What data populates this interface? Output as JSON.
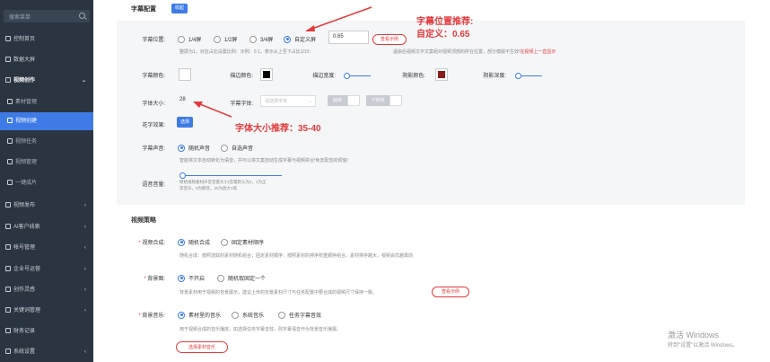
{
  "sidebar": {
    "search_placeholder": "搜索菜单",
    "items": [
      {
        "label": "控制首页",
        "icon": "home-icon"
      },
      {
        "label": "数据大屏",
        "icon": "chart-icon"
      },
      {
        "label": "视频创作",
        "icon": "video-icon"
      },
      {
        "label": "素材管理",
        "icon": "image-icon"
      },
      {
        "label": "视频创建",
        "icon": "edit-icon"
      },
      {
        "label": "视频任务",
        "icon": "task-icon"
      },
      {
        "label": "视频管理",
        "icon": "folder-icon"
      },
      {
        "label": "一键成片",
        "icon": "magic-icon"
      },
      {
        "label": "视频发布",
        "icon": "send-icon"
      },
      {
        "label": "AI客户线索",
        "icon": "user-icon"
      },
      {
        "label": "帐号管理",
        "icon": "account-icon"
      },
      {
        "label": "企业号运营",
        "icon": "building-icon"
      },
      {
        "label": "创作灵感",
        "icon": "idea-icon"
      },
      {
        "label": "关键词管理",
        "icon": "key-icon"
      },
      {
        "label": "财务记录",
        "icon": "money-icon"
      },
      {
        "label": "系统设置",
        "icon": "gear-icon"
      }
    ]
  },
  "subtitle": {
    "section_title": "字幕配置",
    "collapse_label": "收起",
    "position_label": "字幕位置:",
    "position_options": [
      "1/4屏",
      "1/2屏",
      "3/4屏",
      "自定义屏"
    ],
    "position_selected": "自定义屏",
    "position_value": "0.65",
    "view_example": "查看示例",
    "position_hint": "整屏为1，对应占比设置比例：示例：0.1，表示从上至下占比1/10;",
    "position_hint2": "温染后视频文字文案组对视频顶部的所在位置，部分模版不生效!",
    "position_hint_red": "在视频上一直显示",
    "color_label": "字幕颜色:",
    "stroke_color_label": "描边颜色:",
    "stroke_width_label": "描边宽度:",
    "shadow_color_label": "阴影颜色:",
    "shadow_depth_label": "阴影深度:",
    "colors": {
      "text": "#ffffff",
      "stroke": "#000000",
      "shadow": "#8b1c1c"
    },
    "size_label": "字体大小:",
    "size_value": "28",
    "font_label": "字幕字体:",
    "font_placeholder": "请选择字体",
    "italic_label": "斜体",
    "underline_label": "下划线",
    "effect_label": "花字效果:",
    "effect_btn": "选择",
    "voice_label": "字幕声音:",
    "voice_options": [
      "随机声音",
      "自选声音"
    ],
    "voice_hint": "智能将文本自动转化为语音，并可以将文案自动生成字幕与视频拼合!免去配音的烦恼!",
    "volume_label": "语音音量:",
    "volume_hint1": "原始视频素材声音音量大小(音量默认为1，1为正",
    "volume_hint2": "常音乐，0为静音，20为放大1倍"
  },
  "strategy": {
    "section_title": "视频策略",
    "compose_label": "视频合成:",
    "compose_options": [
      "随机合成",
      "固定素材顺序"
    ],
    "compose_hint": "随机合成：按照选取的素材随机组合；固定素材顺序：按照素材的排序权重顺序组合，素材排序越大，视频会优越靠前",
    "bg_label": "背景图:",
    "bg_options": [
      "不开启",
      "随机取固定一个"
    ],
    "bg_hint": "背景素材用于视频的背景展示，建议上传的背景素材尺寸与任务配置中要合成的视频尺寸保持一致。",
    "bg_example": "查看示例",
    "music_label": "背景音乐:",
    "music_options": [
      "素材里的音乐",
      "系统音乐",
      "任务字幕音效"
    ],
    "music_hint": "用于视频合成的音乐播放，如选择任务字幕音效，则字幕语音作为背景音乐播报。",
    "music_btn": "选择素材音乐"
  },
  "annotations": {
    "pos_title": "字幕位置推荐:",
    "pos_value": "自定义：0.65",
    "size_text": "字体大小推荐：35-40"
  },
  "watermark": {
    "line1": "激活 Windows",
    "line2": "转到\"设置\"以激活 Windows。"
  }
}
